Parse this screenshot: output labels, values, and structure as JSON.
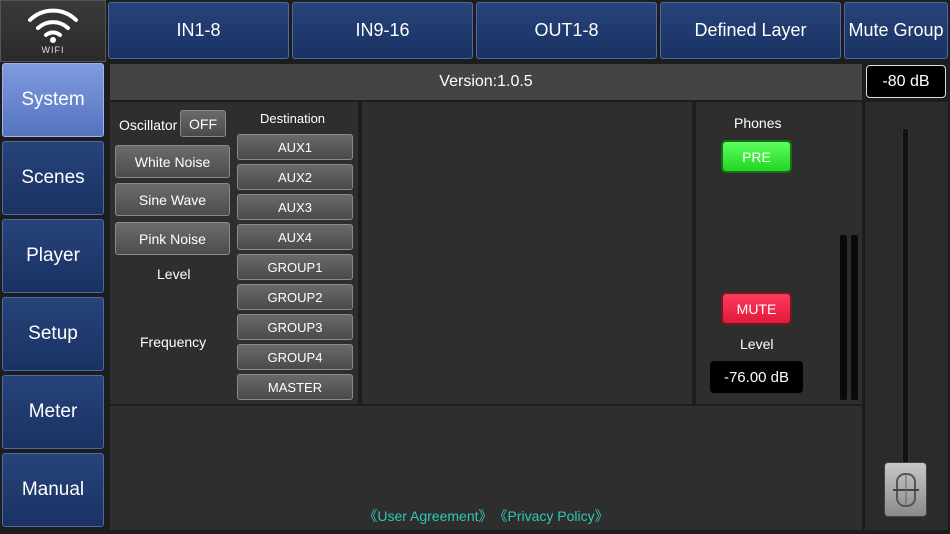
{
  "wifi": {
    "label": "WIFI"
  },
  "top_tabs": [
    "IN1-8",
    "IN9-16",
    "OUT1-8",
    "Defined Layer",
    "Mute Group"
  ],
  "side_tabs": [
    "System",
    "Scenes",
    "Player",
    "Setup",
    "Meter",
    "Manual"
  ],
  "active_side_tab": "System",
  "version": "Version:1.0.5",
  "top_db": "-80 dB",
  "oscillator": {
    "label": "Oscillator",
    "state": "OFF",
    "noise_buttons": [
      "White Noise",
      "Sine Wave",
      "Pink Noise"
    ],
    "level_label": "Level",
    "frequency_label": "Frequency",
    "destination_label": "Destination",
    "destinations": [
      "AUX1",
      "AUX2",
      "AUX3",
      "AUX4",
      "GROUP1",
      "GROUP2",
      "GROUP3",
      "GROUP4",
      "MASTER"
    ]
  },
  "phones": {
    "label": "Phones",
    "pre_label": "PRE",
    "mute_label": "MUTE",
    "level_label": "Level",
    "level_value": "-76.00 dB"
  },
  "footer": {
    "user_agreement": "《User Agreement》",
    "privacy_policy": "《Privacy Policy》"
  },
  "colors": {
    "tab_blue": "#1f3a6e",
    "active_tab": "#6a87d2",
    "pre_green": "#33e833",
    "mute_red": "#f0284a",
    "link_teal": "#2fc8b8"
  }
}
